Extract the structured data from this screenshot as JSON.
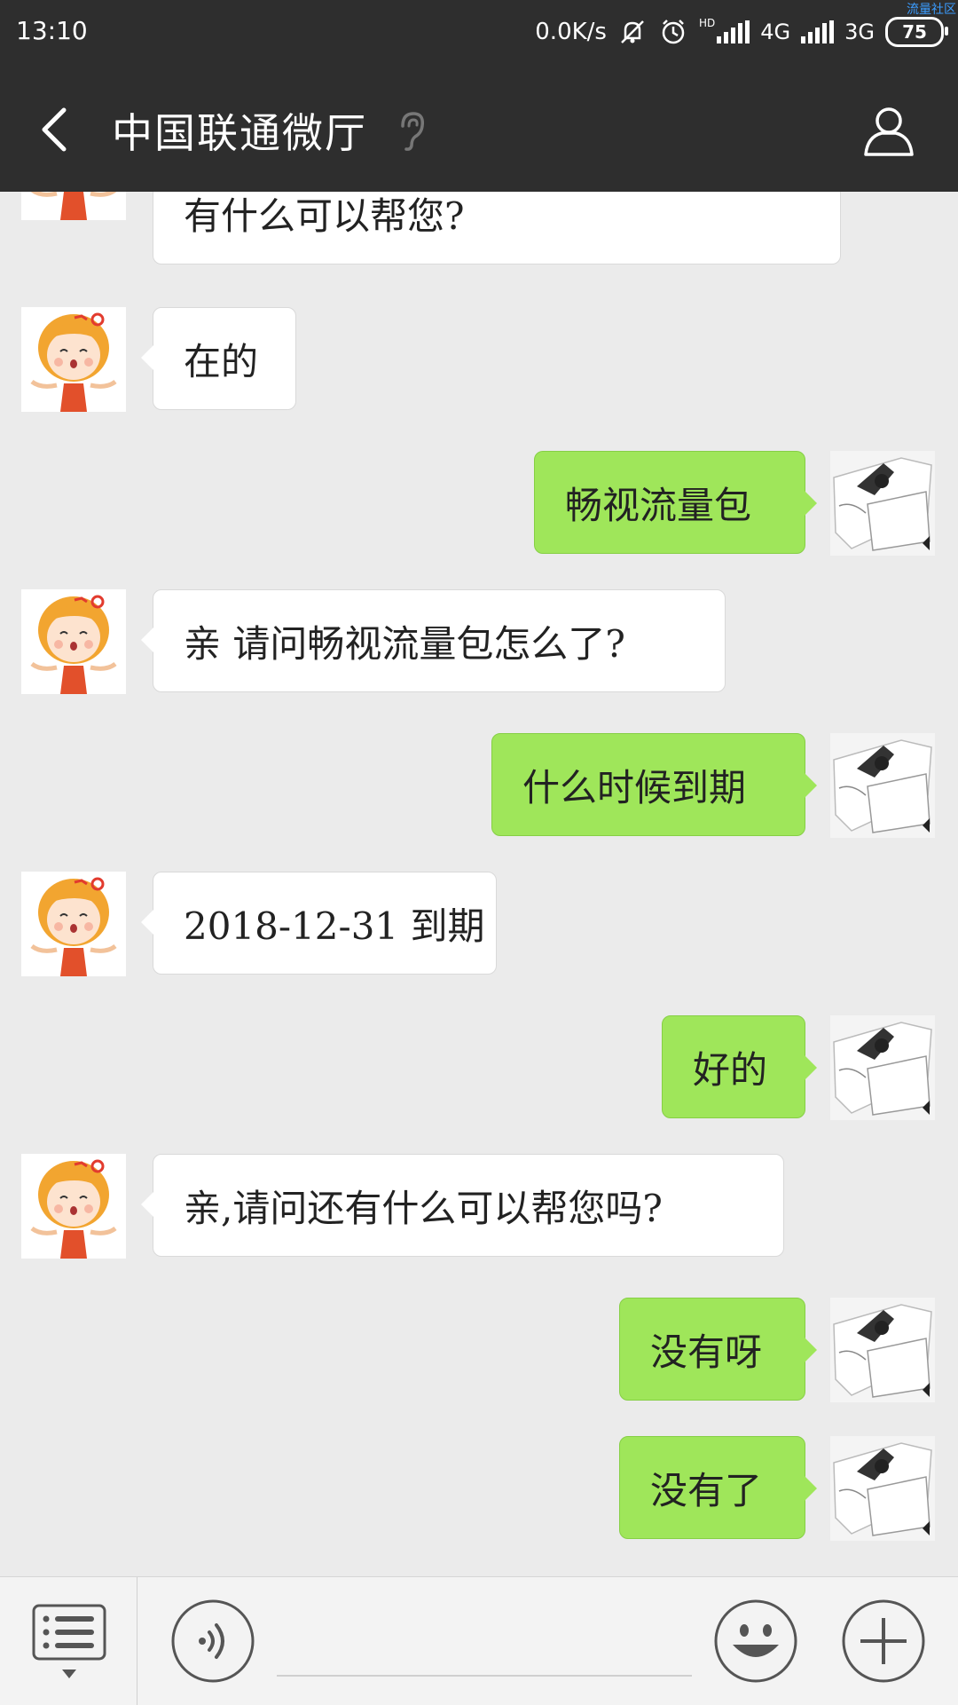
{
  "status_bar": {
    "time": "13:10",
    "net_speed": "0.0K/s",
    "hd_label": "HD",
    "network_1": "4G",
    "network_2": "3G",
    "battery": "75",
    "corner_tag": "流量社区"
  },
  "header": {
    "title": "中国联通微厅",
    "back_icon": "chevron-left-icon",
    "ear_icon": "ear-icon",
    "profile_icon": "person-icon"
  },
  "messages": [
    {
      "from": "agent",
      "text": "有什么可以帮您?"
    },
    {
      "from": "agent",
      "text": "在的"
    },
    {
      "from": "user",
      "text": "畅视流量包"
    },
    {
      "from": "agent",
      "text": "亲  请问畅视流量包怎么了?"
    },
    {
      "from": "user",
      "text": "什么时候到期"
    },
    {
      "from": "agent",
      "text": "2018-12-31 到期"
    },
    {
      "from": "user",
      "text": "好的"
    },
    {
      "from": "agent",
      "text": "亲,请问还有什么可以帮您吗?"
    },
    {
      "from": "user",
      "text": "没有呀"
    },
    {
      "from": "user",
      "text": "没有了"
    }
  ],
  "input_bar": {
    "menu_icon": "list-menu-icon",
    "voice_icon": "voice-icon",
    "emoji_icon": "smiley-icon",
    "plus_icon": "plus-icon",
    "placeholder": ""
  },
  "colors": {
    "header_bg": "#2e2e2e",
    "chat_bg": "#ebebeb",
    "out_bubble": "#9fe65a",
    "in_bubble": "#ffffff"
  }
}
